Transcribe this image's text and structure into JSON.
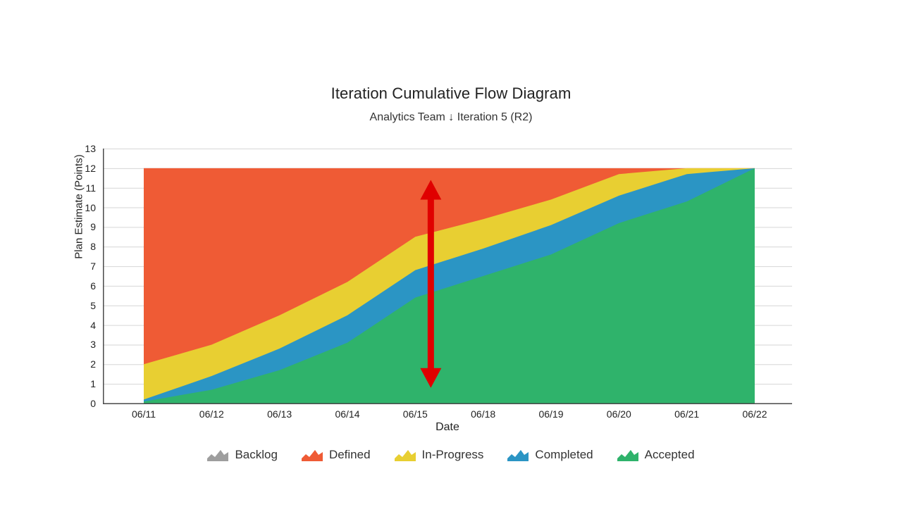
{
  "chart_data": {
    "type": "area",
    "title": "Iteration Cumulative Flow Diagram",
    "subtitle": "Analytics Team ↓ Iteration 5 (R2)",
    "xlabel": "Date",
    "ylabel": "Plan Estimate (Points)",
    "stacked": true,
    "grid": true,
    "legend_position": "bottom",
    "ylim": [
      0,
      13
    ],
    "ytick_labels": [
      "0",
      "1",
      "2",
      "3",
      "4",
      "5",
      "6",
      "7",
      "8",
      "9",
      "10",
      "11",
      "12",
      "13"
    ],
    "categories": [
      "06/11",
      "06/12",
      "06/13",
      "06/14",
      "06/15",
      "06/18",
      "06/19",
      "06/20",
      "06/21",
      "06/22"
    ],
    "series": [
      {
        "name": "Backlog",
        "color": "#9e9e9e",
        "values": [
          0,
          0,
          0,
          0,
          0,
          0,
          0,
          0,
          0,
          0
        ]
      },
      {
        "name": "Defined",
        "color": "#ef5b35",
        "values": [
          10.0,
          9.0,
          7.5,
          5.8,
          3.5,
          2.6,
          1.6,
          0.3,
          0,
          0
        ]
      },
      {
        "name": "In-Progress",
        "color": "#e8cf32",
        "values": [
          1.8,
          1.6,
          1.7,
          1.7,
          1.7,
          1.5,
          1.3,
          1.1,
          0.3,
          0
        ]
      },
      {
        "name": "Completed",
        "color": "#2b95c4",
        "values": [
          0.1,
          0.7,
          1.1,
          1.4,
          1.4,
          1.4,
          1.5,
          1.4,
          1.4,
          0
        ]
      },
      {
        "name": "Accepted",
        "color": "#2fb36b",
        "values": [
          0.1,
          0.7,
          1.7,
          3.1,
          5.4,
          6.5,
          7.6,
          9.2,
          10.3,
          12.0
        ]
      }
    ],
    "totals": [
      12,
      12,
      12,
      12,
      12,
      12,
      12,
      12,
      12,
      12
    ],
    "annotations": [
      {
        "name": "vertical-double-arrow",
        "type": "double-headed-arrow",
        "color": "#e00000",
        "x_category": "06/15",
        "y_top": 11.4,
        "y_bottom": 0.8
      }
    ]
  },
  "legend": {
    "items": [
      {
        "label": "Backlog",
        "color": "#9e9e9e"
      },
      {
        "label": "Defined",
        "color": "#ef5b35"
      },
      {
        "label": "In-Progress",
        "color": "#e8cf32"
      },
      {
        "label": "Completed",
        "color": "#2b95c4"
      },
      {
        "label": "Accepted",
        "color": "#2fb36b"
      }
    ]
  }
}
